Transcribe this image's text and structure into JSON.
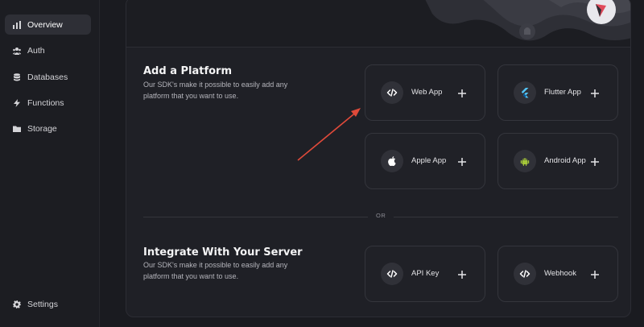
{
  "sidebar": {
    "items": [
      {
        "label": "Overview",
        "icon": "bar-chart-icon",
        "active": true
      },
      {
        "label": "Auth",
        "icon": "users-icon",
        "active": false
      },
      {
        "label": "Databases",
        "icon": "database-icon",
        "active": false
      },
      {
        "label": "Functions",
        "icon": "lightning-icon",
        "active": false
      },
      {
        "label": "Storage",
        "icon": "folder-icon",
        "active": false
      }
    ],
    "settings_label": "Settings",
    "settings_icon": "gear-icon"
  },
  "platforms": {
    "title": "Add a Platform",
    "description": "Our SDK's make it possible to easily add any platform that you want to use.",
    "cards": [
      {
        "label": "Web App",
        "icon": "code-icon"
      },
      {
        "label": "Flutter App",
        "icon": "flutter-icon"
      },
      {
        "label": "Apple App",
        "icon": "apple-icon"
      },
      {
        "label": "Android App",
        "icon": "android-icon"
      }
    ]
  },
  "divider_text": "OR",
  "server": {
    "title": "Integrate With Your Server",
    "description": "Our SDK's make it possible to easily add any platform that you want to use.",
    "cards": [
      {
        "label": "API Key",
        "icon": "code-icon"
      },
      {
        "label": "Webhook",
        "icon": "code-icon"
      }
    ]
  },
  "colors": {
    "background": "#1a1b20",
    "panel": "#1f2026",
    "active_nav": "#2e2f36",
    "arrow": "#e04a3a",
    "flutter_blue": "#54c5f8",
    "android_green": "#a4c639"
  }
}
